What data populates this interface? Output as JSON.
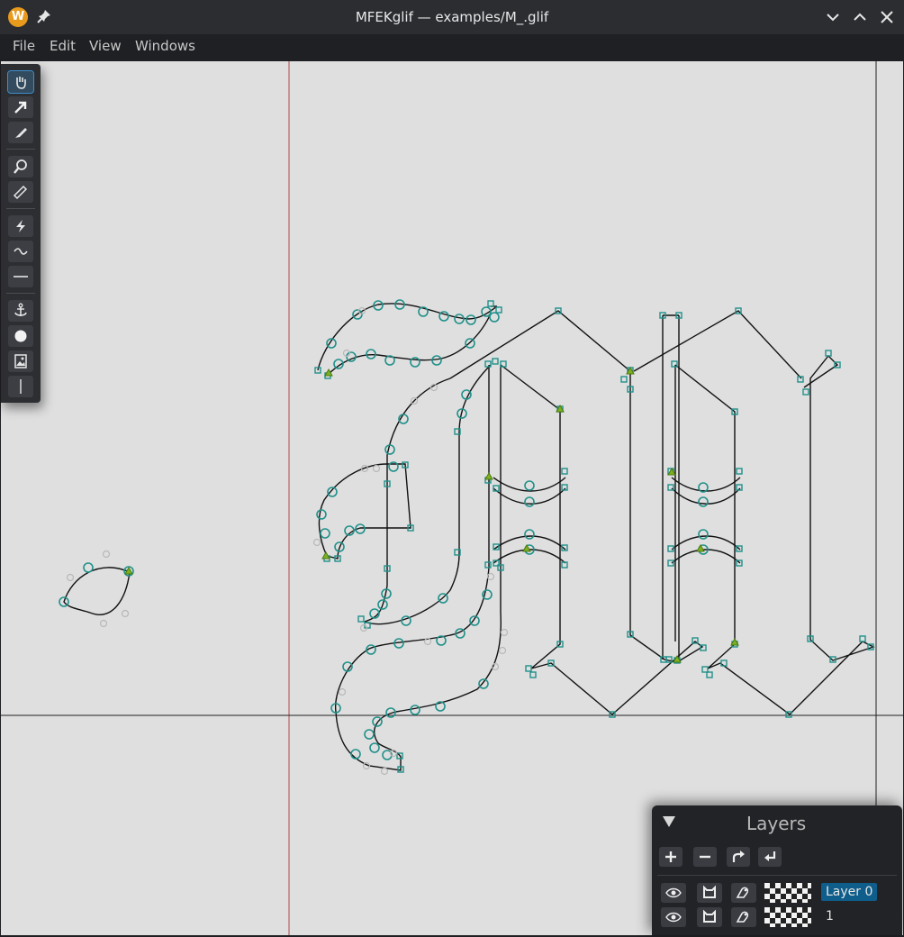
{
  "titlebar": {
    "title": "MFEKglif — examples/M_.glif",
    "app_icon_letter": "W",
    "buttons": [
      "minimize",
      "maximize",
      "close"
    ]
  },
  "menubar": {
    "items": [
      "File",
      "Edit",
      "View",
      "Windows"
    ]
  },
  "toolbox": {
    "tools": [
      {
        "name": "pan",
        "icon": "hand-icon",
        "active": true
      },
      {
        "name": "select",
        "icon": "arrow-icon"
      },
      {
        "name": "pen",
        "icon": "pen-icon"
      },
      {
        "name": "zoom",
        "icon": "magnifier-icon"
      },
      {
        "name": "measure",
        "icon": "ruler-icon"
      },
      {
        "name": "dash",
        "icon": "lightning-icon"
      },
      {
        "name": "pap",
        "icon": "wave-icon"
      },
      {
        "name": "vws",
        "icon": "line-icon"
      },
      {
        "name": "anchors",
        "icon": "anchor-icon"
      },
      {
        "name": "shapes",
        "icon": "circle-icon"
      },
      {
        "name": "image",
        "icon": "image-icon"
      },
      {
        "name": "guidelines",
        "icon": "vertical-line-icon"
      }
    ]
  },
  "layers_panel": {
    "title": "Layers",
    "actions": [
      "add-icon",
      "remove-icon",
      "move-up-icon",
      "move-down-icon"
    ],
    "layers": [
      {
        "name": "Layer 0",
        "selected": true
      },
      {
        "name": "1",
        "selected": false
      }
    ]
  },
  "colors": {
    "point_stroke": "#20908a",
    "handle_point": "#b8b8b8",
    "guide_red": "#b04a4a",
    "canvas_bg": "#dfdfdf",
    "selection": "#0e5d8a"
  }
}
